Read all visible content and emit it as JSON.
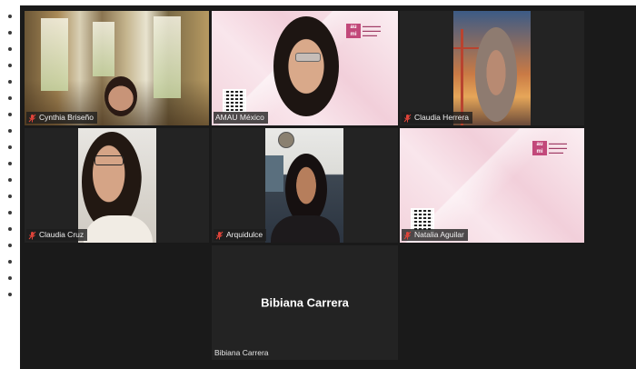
{
  "participants": [
    {
      "name": "Cynthia Briseño",
      "muted": true
    },
    {
      "name": "AMAU México",
      "muted": false
    },
    {
      "name": "Claudia Herrera",
      "muted": true
    },
    {
      "name": "Claudia Cruz",
      "muted": true
    },
    {
      "name": "Arquidulce",
      "muted": true
    },
    {
      "name": "Natalia Aguilar",
      "muted": true
    },
    {
      "name": "Bibiana Carrera",
      "muted": false
    }
  ],
  "active_speaker": "AMAU México",
  "colors": {
    "active_border": "#c9da4a",
    "mic_off": "#e0443a",
    "tile_bg": "#232323",
    "brand_pink": "#c2487a"
  },
  "icons": {
    "muted": "mic-off-icon"
  }
}
